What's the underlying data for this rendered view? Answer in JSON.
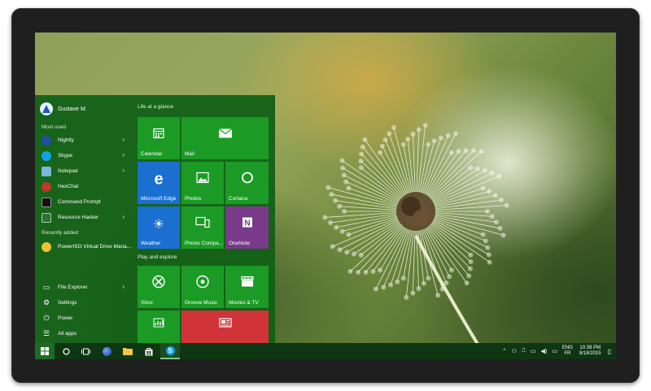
{
  "user": {
    "name": "Gustave M."
  },
  "start": {
    "most_used_label": "Most used",
    "recently_added_label": "Recently added",
    "most_used": [
      {
        "label": "Nightly",
        "has_submenu": true,
        "icon": "nightly-icon",
        "color": "#1d4fa3"
      },
      {
        "label": "Skype",
        "has_submenu": true,
        "icon": "skype-icon",
        "color": "#0ea5e6"
      },
      {
        "label": "Notepad",
        "has_submenu": true,
        "icon": "notepad-icon",
        "color": "#7bb7d8"
      },
      {
        "label": "HexChat",
        "has_submenu": false,
        "icon": "hexchat-icon",
        "color": "#c0382b"
      },
      {
        "label": "Command Prompt",
        "has_submenu": false,
        "icon": "command-prompt-icon",
        "color": "#111111"
      },
      {
        "label": "Resource Hacker",
        "has_submenu": true,
        "icon": "resource-hacker-icon",
        "color": "#2f6f3a"
      }
    ],
    "recently_added": [
      {
        "label": "PowerISO Virtual Drive Mana...",
        "icon": "poweriso-icon",
        "color": "#f1c232"
      }
    ],
    "bottom": [
      {
        "label": "File Explorer",
        "has_submenu": true,
        "icon": "folder-icon"
      },
      {
        "label": "Settings",
        "has_submenu": false,
        "icon": "gear-icon"
      },
      {
        "label": "Power",
        "has_submenu": false,
        "icon": "power-icon"
      },
      {
        "label": "All apps",
        "has_submenu": false,
        "icon": "list-icon"
      }
    ]
  },
  "tiles": {
    "group1_label": "Life at a glance",
    "group2_label": "Play and explore",
    "calendar": "Calendar",
    "mail": "Mail",
    "edge": "Microsoft Edge",
    "photos": "Photos",
    "cortana": "Cortana",
    "weather": "Weather",
    "phone": "Phone Compa...",
    "onenote": "OneNote",
    "xbox": "Xbox",
    "groove": "Groove Music",
    "movies": "Movies & TV"
  },
  "colors": {
    "tile_green": "#1b9b25",
    "edge_blue": "#1a6fd1",
    "onenote_purple": "#7a3a8a",
    "news_red": "#d13438"
  },
  "taskbar": {
    "language_primary": "ENG",
    "language_secondary": "FR",
    "time": "10:38 PM",
    "date": "8/18/2015"
  }
}
